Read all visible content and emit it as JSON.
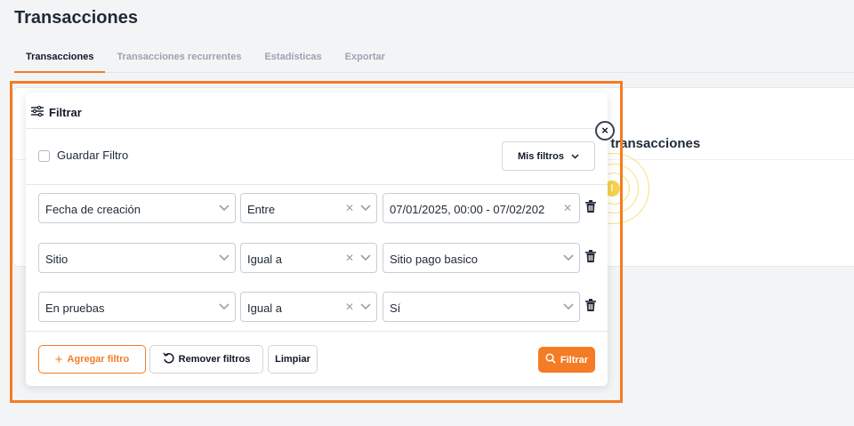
{
  "page": {
    "title": "Transacciones"
  },
  "tabs": [
    {
      "label": "Transacciones",
      "active": true
    },
    {
      "label": "Transacciones recurrentes",
      "active": false
    },
    {
      "label": "Estadísticas",
      "active": false
    },
    {
      "label": "Exportar",
      "active": false
    }
  ],
  "background": {
    "empty_text_partial": "ron transacciones",
    "warning_glyph": "!"
  },
  "filter_panel": {
    "title": "Filtrar",
    "close_glyph": "×",
    "save_filter_label": "Guardar Filtro",
    "save_filter_checked": false,
    "my_filters_label": "Mis filtros",
    "rows": [
      {
        "field": "Fecha de creación",
        "operator": "Entre",
        "value": "07/01/2025, 00:00 - 07/02/202",
        "value_type": "date-range"
      },
      {
        "field": "Sitio",
        "operator": "Igual a",
        "value": "Sitio pago basico",
        "value_type": "select"
      },
      {
        "field": "En pruebas",
        "operator": "Igual a",
        "value": "Sí",
        "value_type": "select"
      }
    ],
    "buttons": {
      "add": "Agregar filtro",
      "remove": "Remover filtros",
      "clear": "Limpiar",
      "apply": "Filtrar"
    }
  },
  "colors": {
    "accent": "#f47c24",
    "warning": "#f7d24c"
  },
  "icons": {
    "filter": "sliders-icon",
    "chevron": "chevron-down-icon",
    "trash": "trash-icon",
    "clear": "close-icon",
    "undo": "undo-icon",
    "search": "search-icon",
    "plus": "plus-icon"
  }
}
